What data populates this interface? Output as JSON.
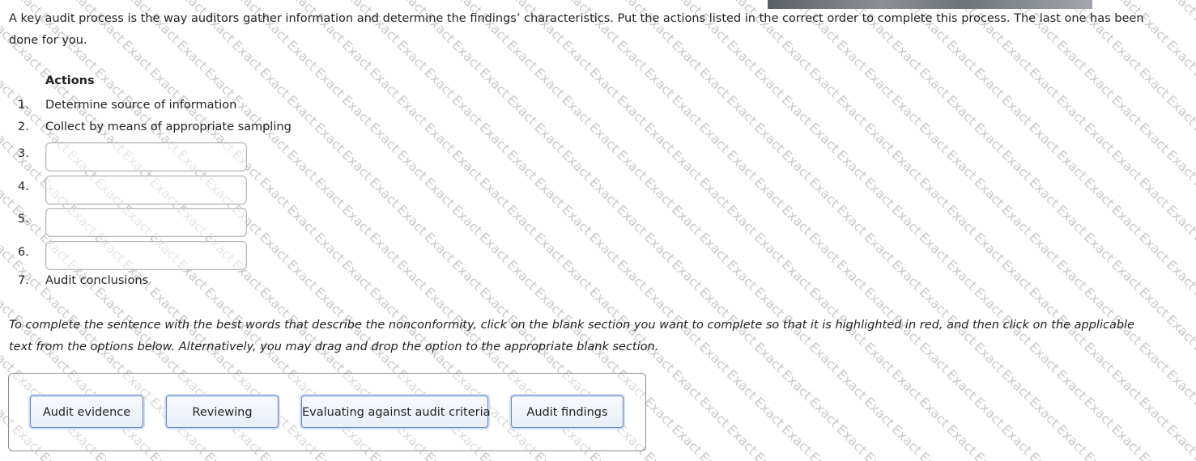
{
  "question": {
    "intro": "A key audit process is the way auditors gather information and determine the findings’ characteristics. Put the actions listed in the correct order to complete this process. The last one has been done for you.",
    "actions_heading": "Actions",
    "actions": [
      {
        "number": "1.",
        "text": "Determine source of information"
      },
      {
        "number": "2.",
        "text": "Collect by means of appropriate sampling"
      },
      {
        "number": "3.",
        "text": ""
      },
      {
        "number": "4.",
        "text": ""
      },
      {
        "number": "5.",
        "text": ""
      },
      {
        "number": "6.",
        "text": ""
      },
      {
        "number": "7.",
        "text": "Audit conclusions"
      }
    ],
    "instructions": "To complete the sentence with the best words that describe the nonconformity, click on the blank section you want to complete so that it is highlighted in red, and then click on the applicable text from the options below. Alternatively, you may drag and drop the option to the appropriate blank section."
  },
  "options": [
    {
      "label": "Audit evidence"
    },
    {
      "label": "Reviewing"
    },
    {
      "label": "Evaluating against audit criteria"
    },
    {
      "label": "Audit findings"
    }
  ],
  "watermark": {
    "text": "Exact2Pass",
    "color": "#c9c9c9"
  },
  "colors": {
    "text": "#222222",
    "slot_border": "#b9b9b9",
    "option_border": "#5f87c9",
    "panel_border": "#8e8e8e"
  }
}
